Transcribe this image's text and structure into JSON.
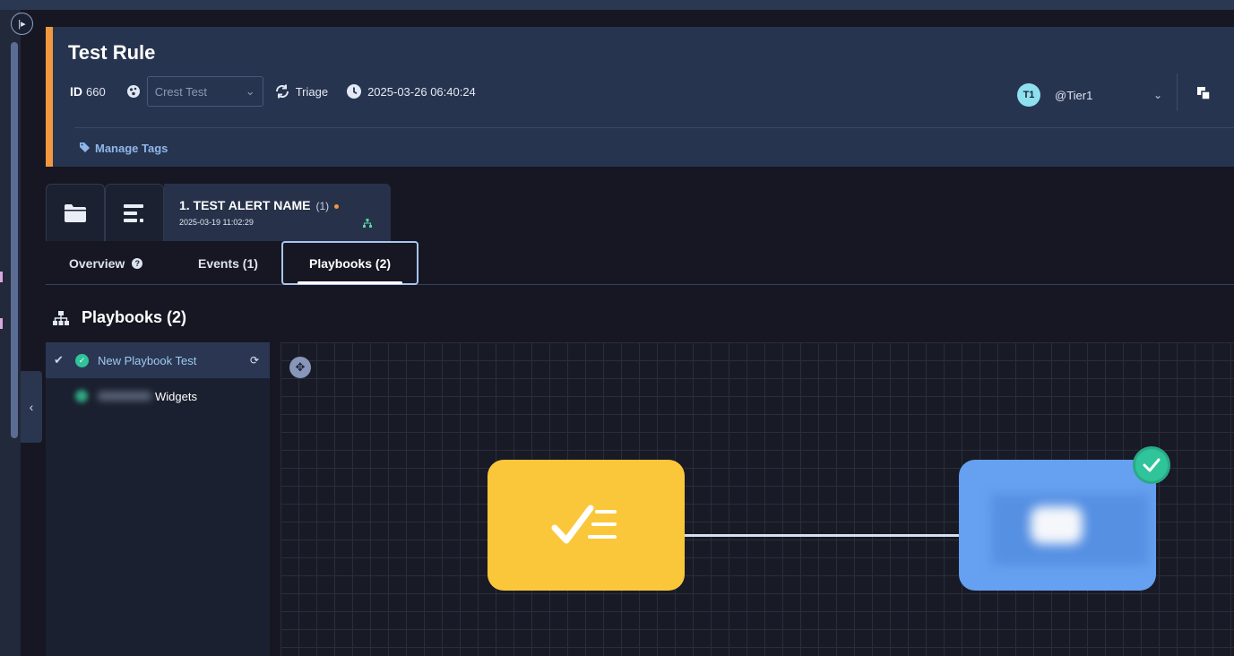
{
  "header": {
    "title": "Test Rule",
    "id_label": "ID",
    "id_value": "660",
    "organization_select": "Crest Test",
    "status": "Triage",
    "timestamp": "2025-03-26 06:40:24",
    "assignee_initials": "T1",
    "assignee_name": "@Tier1",
    "manage_tags": "Manage Tags"
  },
  "alert_tab": {
    "title": "1. TEST ALERT NAME",
    "count": "(1)",
    "date": "2025-03-19 11:02:29"
  },
  "tabs": [
    {
      "label": "Overview"
    },
    {
      "label": "Events (1)"
    },
    {
      "label": "Playbooks (2)"
    }
  ],
  "playbooks": {
    "heading": "Playbooks (2)",
    "items": [
      {
        "name": "New Playbook Test"
      },
      {
        "name": "Widgets"
      }
    ]
  },
  "colors": {
    "accent_orange": "#f0973f",
    "node_yellow": "#fbc73a",
    "node_blue": "#66a0f0",
    "success_green": "#2fc49a"
  }
}
